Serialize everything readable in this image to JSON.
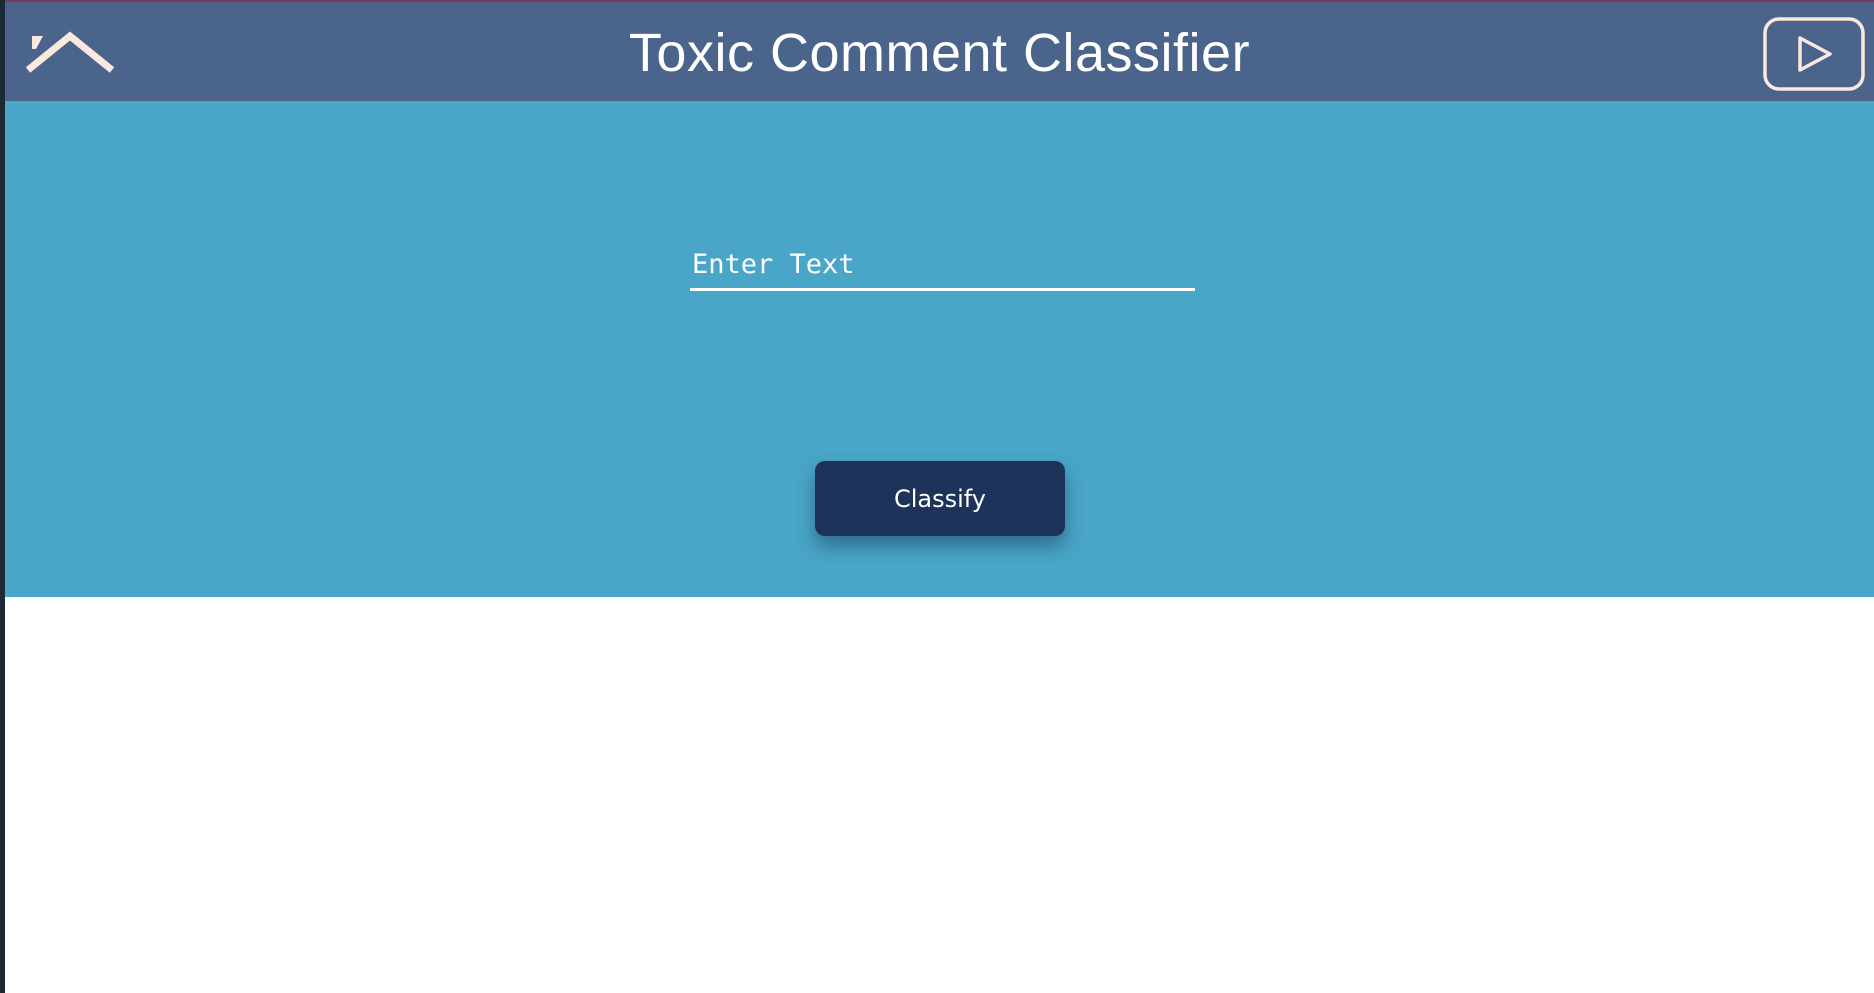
{
  "header": {
    "title": "Toxic Comment Classifier",
    "home_icon": "home-roof-icon",
    "play_icon": "youtube-play-icon",
    "background": "#4b648c"
  },
  "form": {
    "input_placeholder": "Enter Text",
    "input_value": "",
    "classify_label": "Classify"
  },
  "colors": {
    "hero_background": "#49a6c8",
    "button_background": "#1e3359",
    "icon_color": "#fbe9df",
    "body_background": "#ffffff"
  }
}
